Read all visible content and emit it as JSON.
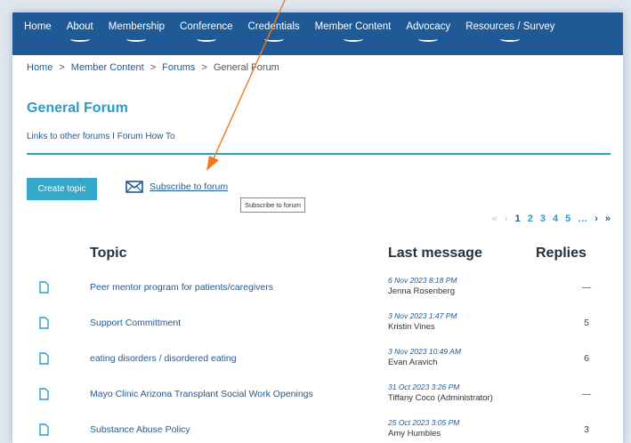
{
  "nav": {
    "items": [
      {
        "label": "Home",
        "swoosh": false
      },
      {
        "label": "About",
        "swoosh": true
      },
      {
        "label": "Membership",
        "swoosh": true
      },
      {
        "label": "Conference",
        "swoosh": true
      },
      {
        "label": "Credentials",
        "swoosh": true
      },
      {
        "label": "Member Content",
        "swoosh": true
      },
      {
        "label": "Advocacy",
        "swoosh": true
      },
      {
        "label": "Resources / Survey",
        "swoosh": true
      }
    ]
  },
  "breadcrumb": {
    "home": "Home",
    "sep1": ">",
    "member_content": "Member Content",
    "sep2": ">",
    "forums": "Forums",
    "sep3": ">",
    "current": "General Forum"
  },
  "page": {
    "title": "General Forum",
    "links": "Links to other forums I Forum How To"
  },
  "actions": {
    "create_topic": "Create topic",
    "subscribe": "Subscribe to forum",
    "tooltip": "Subscribe to forum"
  },
  "pager": {
    "first": "«",
    "prev": "‹",
    "pages": [
      "1",
      "2",
      "3",
      "4",
      "5"
    ],
    "current": "1",
    "ellipsis": "…",
    "next": "›",
    "last": "»"
  },
  "table": {
    "headers": {
      "topic": "Topic",
      "last_message": "Last message",
      "replies": "Replies"
    },
    "rows": [
      {
        "topic": "Peer mentor program for patients/caregivers",
        "date": "6 Nov 2023 8:18 PM",
        "author": "Jenna Rosenberg",
        "replies": "—"
      },
      {
        "topic": "Support Committment",
        "date": "3 Nov 2023 1:47 PM",
        "author": "Kristin Vines",
        "replies": "5"
      },
      {
        "topic": "eating disorders / disordered eating",
        "date": "3 Nov 2023 10:49 AM",
        "author": "Evan Aravich",
        "replies": "6"
      },
      {
        "topic": "Mayo Clinic Arizona Transplant Social Work Openings",
        "date": "31 Oct 2023 3:26 PM",
        "author": "Tiffany Coco (Administrator)",
        "replies": "—"
      },
      {
        "topic": "Substance Abuse Policy",
        "date": "25 Oct 2023 3:05 PM",
        "author": "Amy Humbles",
        "replies": "3"
      }
    ]
  },
  "colors": {
    "nav_bg": "#1f5a96",
    "accent": "#2a9cc8",
    "button": "#35a7c9",
    "annotation_arrow": "#f07a1c"
  },
  "icons": {
    "mail": "mail-icon",
    "document": "document-icon"
  }
}
